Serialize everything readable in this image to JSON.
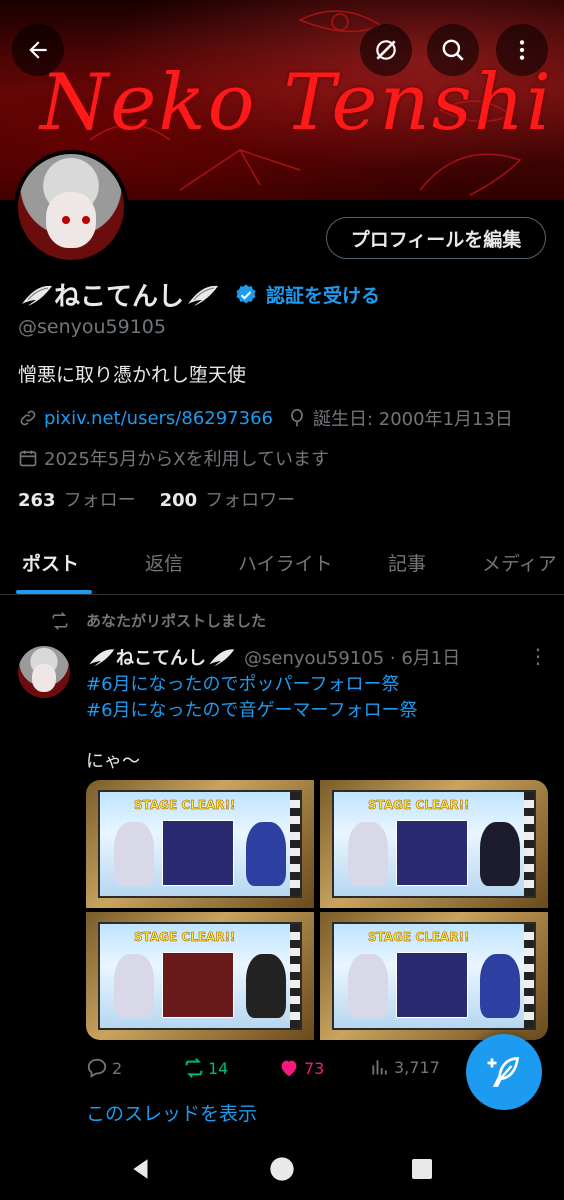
{
  "banner": {
    "title": "Neko Tenshi"
  },
  "header_icons": {
    "back": "arrow-left-icon",
    "grok": "grok-icon",
    "search": "search-icon",
    "more": "more-vertical-icon"
  },
  "profile": {
    "edit_label": "プロフィールを編集",
    "name": "ねこてんし",
    "verify_label": "認証を受ける",
    "handle": "@senyou59105",
    "bio": "憎悪に取り憑かれし堕天使",
    "link": "pixiv.net/users/86297366",
    "birthday": "誕生日: 2000年1月13日",
    "joined": "2025年5月からXを利用しています",
    "following_count": "263",
    "following_label": "フォロー",
    "followers_count": "200",
    "followers_label": "フォロワー"
  },
  "tabs": [
    {
      "label": "ポスト",
      "active": true
    },
    {
      "label": "返信",
      "active": false
    },
    {
      "label": "ハイライト",
      "active": false
    },
    {
      "label": "記事",
      "active": false
    },
    {
      "label": "メディア",
      "active": false
    }
  ],
  "post": {
    "repost_note": "あなたがリポストしました",
    "author": "ねこてんし",
    "meta": "@senyou59105 · 6月1日",
    "hashtags": [
      "#6月になったのでポッパーフォロー祭",
      "#6月になったので音ゲーマーフォロー祭"
    ],
    "text": "にゃ～",
    "images": [
      {
        "stage_text": "STAGE CLEAR!!"
      },
      {
        "stage_text": "STAGE CLEAR!!"
      },
      {
        "stage_text": "STAGE CLEAR!!"
      },
      {
        "stage_text": "STAGE CLEAR!!"
      }
    ],
    "replies": "2",
    "reposts": "14",
    "likes": "73",
    "views": "3,717",
    "thread_label": "このスレッドを表示"
  },
  "colors": {
    "accent": "#1d9bf0",
    "like": "#f91880",
    "repost": "#00ba7c",
    "banner_text": "#ff1a1a"
  }
}
